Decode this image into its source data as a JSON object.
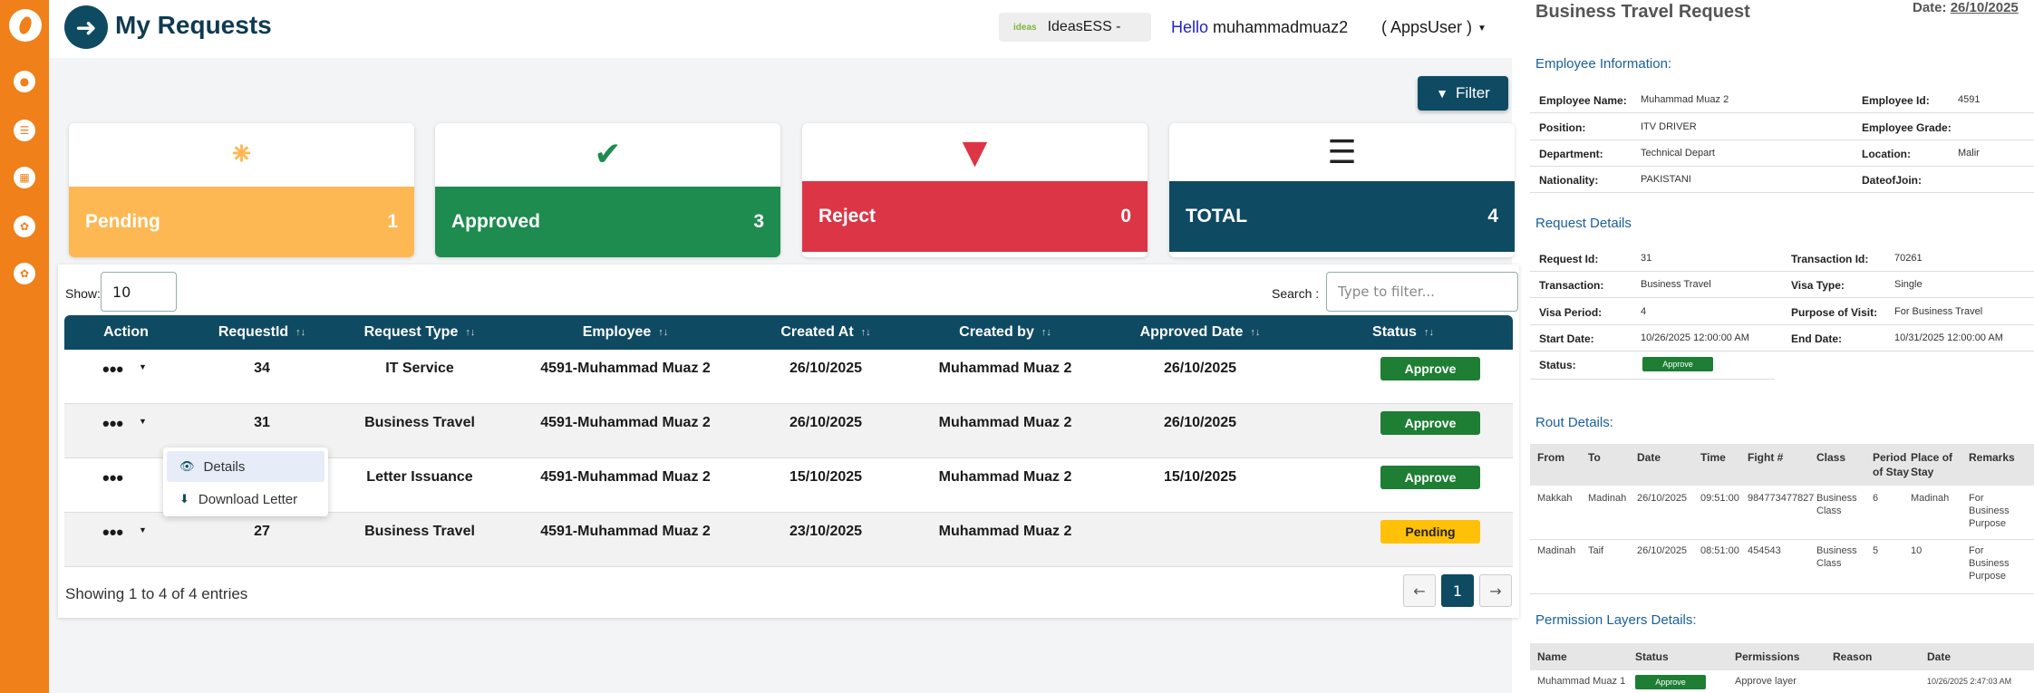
{
  "header": {
    "page_title": "My Requests",
    "org_logo": "ideas",
    "org_name": "IdeasESS -",
    "hello_label": "Hello",
    "username": "muhammadmuaz2",
    "role": "( AppsUser )"
  },
  "toolbar": {
    "filter_label": "Filter"
  },
  "summary": {
    "pending": {
      "label": "Pending",
      "count": "1"
    },
    "approved": {
      "label": "Approved",
      "count": "3"
    },
    "reject": {
      "label": "Reject",
      "count": "0"
    },
    "total": {
      "label": "TOTAL",
      "count": "4"
    }
  },
  "table": {
    "show_label": "Show:",
    "show_value": "10",
    "search_label": "Search :",
    "search_placeholder": "Type to filter...",
    "columns": [
      "Action",
      "RequestId",
      "Request Type",
      "Employee",
      "Created At",
      "Created by",
      "Approved Date",
      "Status"
    ],
    "rows": [
      {
        "request_id": "34",
        "request_type": "IT Service",
        "employee": "4591-Muhammad Muaz 2",
        "created_at": "26/10/2025",
        "created_by": "Muhammad Muaz 2",
        "approved_date": "26/10/2025",
        "status": "Approve"
      },
      {
        "request_id": "31",
        "request_type": "Business Travel",
        "employee": "4591-Muhammad Muaz 2",
        "created_at": "26/10/2025",
        "created_by": "Muhammad Muaz 2",
        "approved_date": "26/10/2025",
        "status": "Approve"
      },
      {
        "request_id": "",
        "request_type": "Letter Issuance",
        "employee": "4591-Muhammad Muaz 2",
        "created_at": "15/10/2025",
        "created_by": "Muhammad Muaz 2",
        "approved_date": "15/10/2025",
        "status": "Approve"
      },
      {
        "request_id": "27",
        "request_type": "Business Travel",
        "employee": "4591-Muhammad Muaz 2",
        "created_at": "23/10/2025",
        "created_by": "Muhammad Muaz 2",
        "approved_date": "",
        "status": "Pending"
      }
    ],
    "action_menu": {
      "details": "Details",
      "download": "Download Letter"
    },
    "showing_text": "Showing 1 to 4 of 4 entries",
    "current_page": "1"
  },
  "colors": {
    "sidebar": "#f08019",
    "primary": "#0f4a63",
    "pending": "#fdb854",
    "approved": "#1e8b4f",
    "reject": "#dc3545",
    "status_approve": "#1e7e34",
    "status_pending": "#ffc107"
  },
  "detail": {
    "title": "Business Travel Request",
    "date_label": "Date:",
    "date_value": "26/10/2025",
    "employee_section": "Employee Information:",
    "employee": {
      "name_label": "Employee Name:",
      "name": "Muhammad Muaz 2",
      "id_label": "Employee Id:",
      "id": "4591",
      "position_label": "Position:",
      "position": "ITV DRIVER",
      "grade_label": "Employee Grade:",
      "grade": "",
      "department_label": "Department:",
      "department": "Technical Depart",
      "location_label": "Location:",
      "location": "Malir",
      "nationality_label": "Nationality:",
      "nationality": "PAKISTANI",
      "doj_label": "DateofJoin:",
      "doj": ""
    },
    "request_section": "Request Details",
    "request": {
      "rid_label": "Request Id:",
      "rid": "31",
      "tid_label": "Transaction Id:",
      "tid": "70261",
      "trans_label": "Transaction:",
      "trans": "Business Travel",
      "visa_type_label": "Visa Type:",
      "visa_type": "Single",
      "visa_period_label": "Visa Period:",
      "visa_period": "4",
      "purpose_label": "Purpose of Visit:",
      "purpose": "For Business Travel",
      "start_label": "Start Date:",
      "start": "10/26/2025 12:00:00 AM",
      "end_label": "End Date:",
      "end": "10/31/2025 12:00:00 AM",
      "status_label": "Status:",
      "status": "Approve"
    },
    "route_section": "Rout Details:",
    "route_columns": {
      "from": "From",
      "to": "To",
      "date": "Date",
      "time": "Time",
      "flight": "Fight #",
      "class": "Class",
      "period_1": "Period",
      "period_2": "of Stay",
      "place_1": "Place of",
      "place_2": "Stay",
      "remarks": "Remarks"
    },
    "routes": [
      {
        "from": "Makkah",
        "to": "Madinah",
        "date": "26/10/2025",
        "time": "09:51:00",
        "flight": "984773477827",
        "class_1": "Business",
        "class_2": "Class",
        "period": "6",
        "place": "Madinah",
        "remarks_1": "For",
        "remarks_2": "Business",
        "remarks_3": "Purpose"
      },
      {
        "from": "Madinah",
        "to": "Taif",
        "date": "26/10/2025",
        "time": "08:51:00",
        "flight": "454543",
        "class_1": "Business",
        "class_2": "Class",
        "period": "5",
        "place": "10",
        "remarks_1": "For",
        "remarks_2": "Business",
        "remarks_3": "Purpose"
      }
    ],
    "permission_section": "Permission Layers Details:",
    "permission_columns": {
      "name": "Name",
      "status": "Status",
      "permissions": "Permissions",
      "reason": "Reason",
      "date": "Date"
    },
    "permission_row": {
      "name": "Muhammad Muaz 1",
      "status": "Approve",
      "permissions": "Approve layer",
      "reason": "",
      "date": "10/26/2025 2:47:03 AM"
    }
  }
}
